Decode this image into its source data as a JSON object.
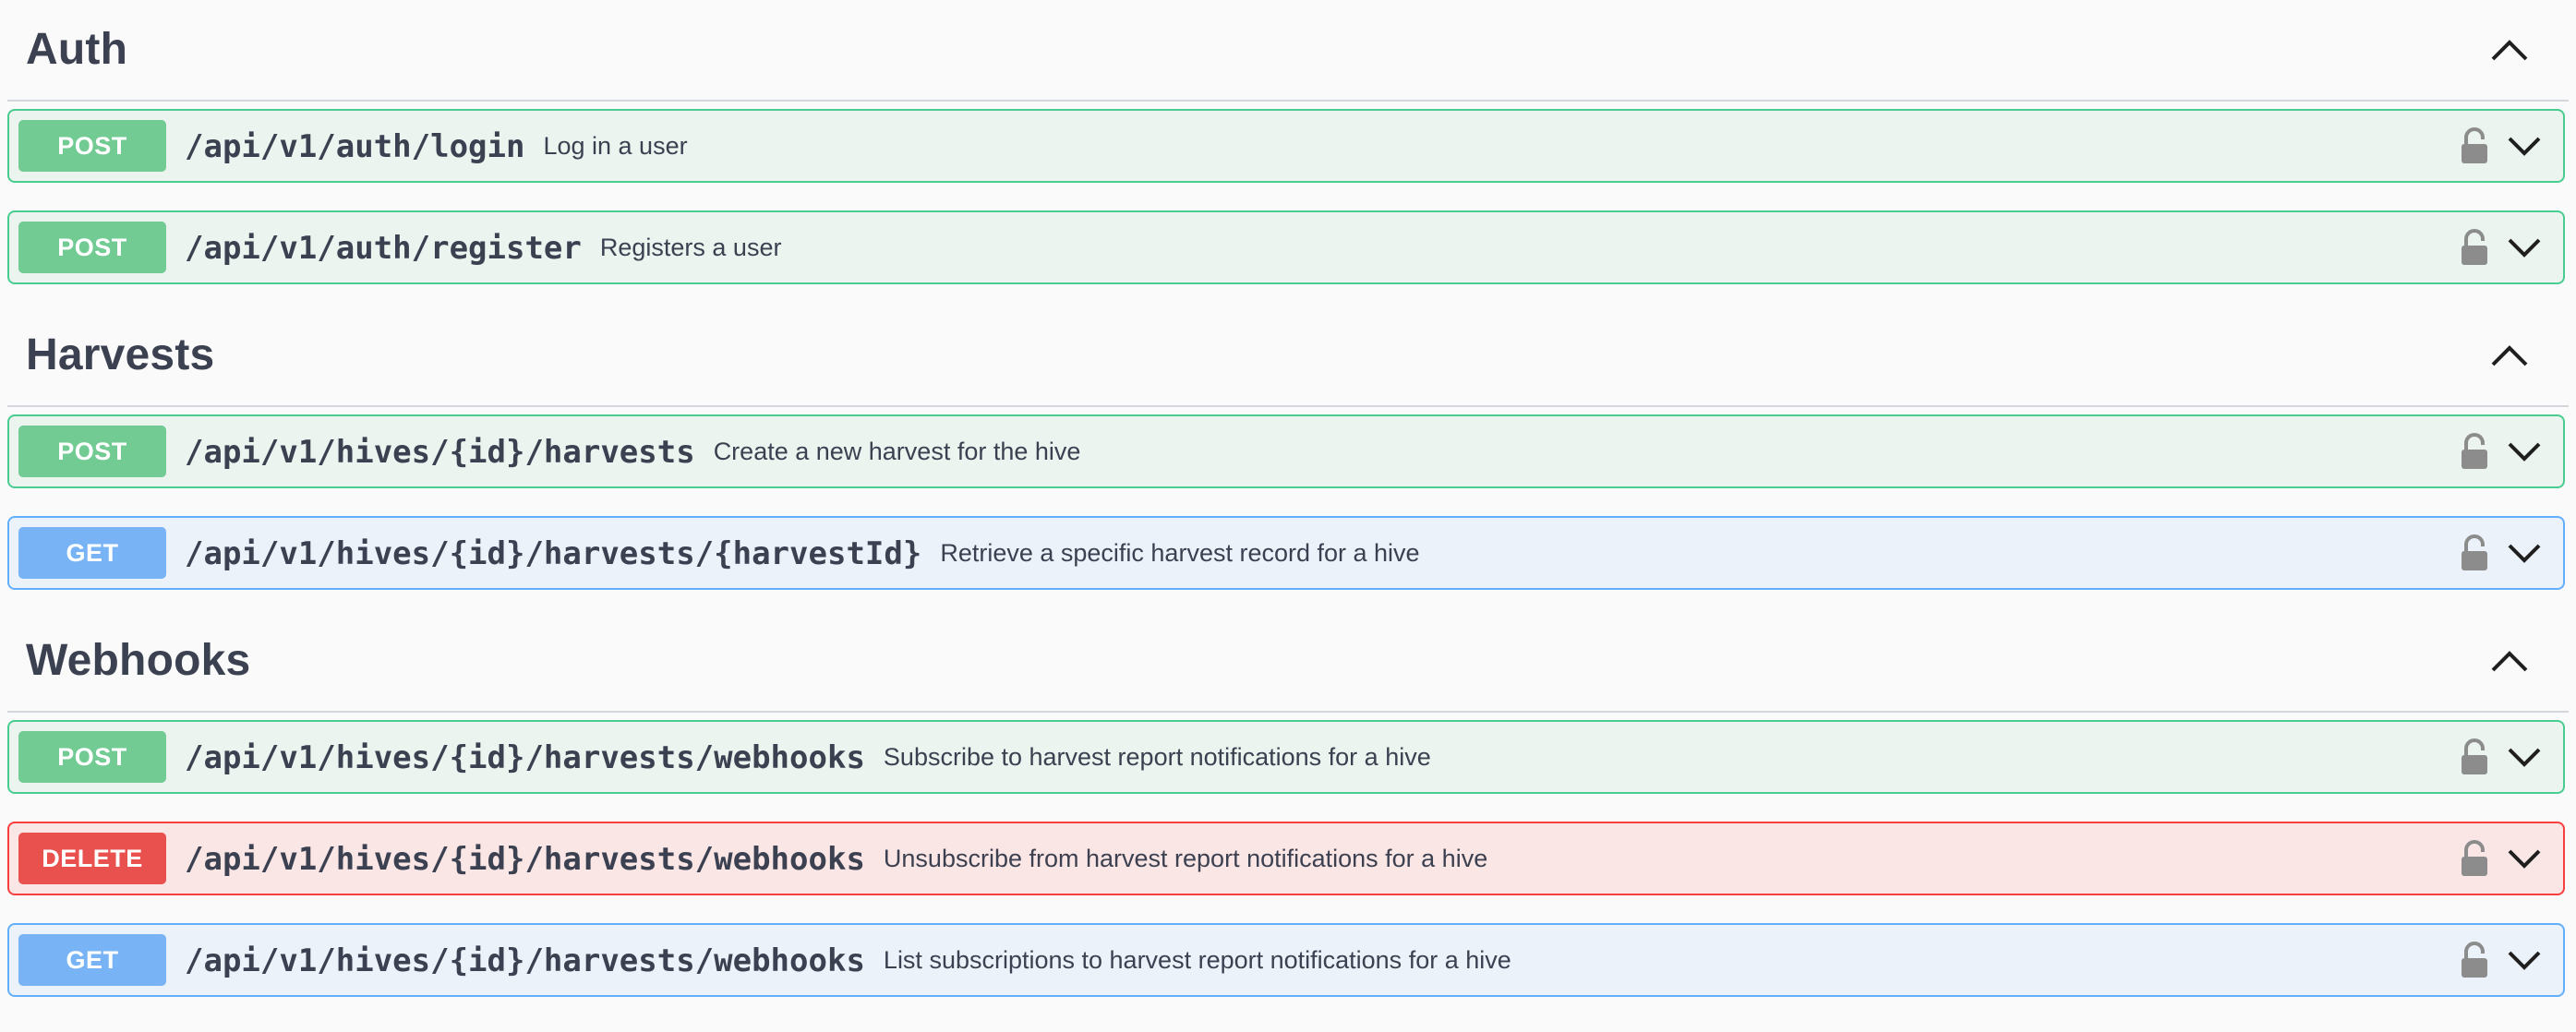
{
  "sections": [
    {
      "title": "Auth",
      "ops": [
        {
          "method": "POST",
          "path": "/api/v1/auth/login",
          "summary": "Log in a user"
        },
        {
          "method": "POST",
          "path": "/api/v1/auth/register",
          "summary": "Registers a user"
        }
      ]
    },
    {
      "title": "Harvests",
      "ops": [
        {
          "method": "POST",
          "path": "/api/v1/hives/{id}/harvests",
          "summary": "Create a new harvest for the hive"
        },
        {
          "method": "GET",
          "path": "/api/v1/hives/{id}/harvests/{harvestId}",
          "summary": "Retrieve a specific harvest record for a hive"
        }
      ]
    },
    {
      "title": "Webhooks",
      "ops": [
        {
          "method": "POST",
          "path": "/api/v1/hives/{id}/harvests/webhooks",
          "summary": "Subscribe to harvest report notifications for a hive"
        },
        {
          "method": "DELETE",
          "path": "/api/v1/hives/{id}/harvests/webhooks",
          "summary": "Unsubscribe from harvest report notifications for a hive"
        },
        {
          "method": "GET",
          "path": "/api/v1/hives/{id}/harvests/webhooks",
          "summary": "List subscriptions to harvest report notifications for a hive"
        }
      ]
    }
  ],
  "colors": {
    "post_badge": "#72cb93",
    "get_badge": "#78b4f5",
    "delete_badge": "#e9514f"
  },
  "icons": {
    "collapse": "chevron-up-icon",
    "expand": "chevron-down-icon",
    "auth": "lock-icon"
  }
}
